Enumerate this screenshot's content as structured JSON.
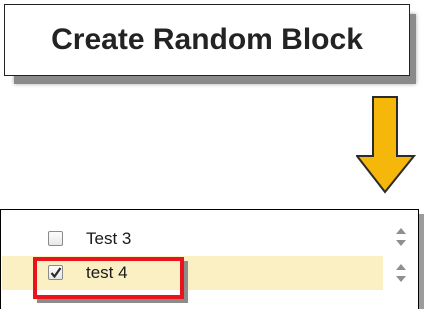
{
  "button": {
    "label": "Create Random Block"
  },
  "colors": {
    "arrow": "#f5b70a",
    "arrow_outline": "#2b2b2b",
    "highlight_border": "#e8131b",
    "selected_row_bg": "#fbf0c4"
  },
  "list": {
    "items": [
      {
        "label": "Test 3",
        "checked": false
      },
      {
        "label": "test 4",
        "checked": true
      }
    ]
  },
  "icons": {
    "arrow": "down-arrow-icon",
    "sorter": "sort-arrows-icon",
    "check": "checkmark-icon"
  }
}
